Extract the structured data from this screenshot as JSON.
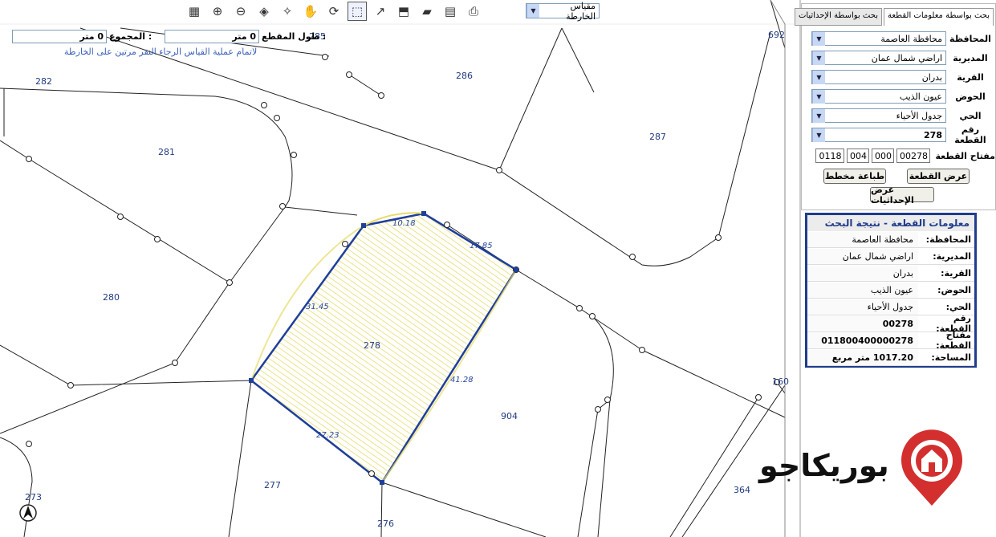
{
  "toolbar": {
    "tools": [
      "legend-icon",
      "zoom-in-icon",
      "zoom-out-icon",
      "layers-icon",
      "identify-icon",
      "pan-hand-icon",
      "refresh-map-icon",
      "measure-area-icon",
      "measure-distance-icon",
      "select-icon",
      "eraser-icon",
      "ruler-icon",
      "print-icon"
    ],
    "scale_value": "مقياس الخارطة"
  },
  "measure": {
    "total_label": "المجموع :",
    "total_value": "0 متر",
    "segment_label": "طول المقطع :",
    "segment_value": "0 متر",
    "hint": "لاتمام عملية القياس الرجاء النقر مرتين على الخارطة"
  },
  "map": {
    "parcels": [
      "282",
      "281",
      "280",
      "286",
      "287",
      "278",
      "904",
      "277",
      "276",
      "273",
      "364",
      "692",
      "285",
      "160"
    ],
    "dimensions": [
      "10.18",
      "17.85",
      "31.45",
      "41.28",
      "27.23"
    ],
    "north_symbol": "Λ"
  },
  "search_panel": {
    "tab_active": "بحث بواسطة معلومات القطعة",
    "tab_other": "بحث بواسطة الإحداثيات",
    "fields": [
      {
        "label": "المحافظة",
        "value": "محافظة العاصمة"
      },
      {
        "label": "المديرية",
        "value": "اراضي شمال عمان"
      },
      {
        "label": "القرية",
        "value": "بدران"
      },
      {
        "label": "الحوض",
        "value": "عيون الذيب"
      },
      {
        "label": "الحي",
        "value": "جدول الأحياء"
      },
      {
        "label": "رقم القطعة",
        "value": "278"
      }
    ],
    "key_label": "مفتاح القطعة",
    "key_parts": [
      "00278",
      "000",
      "004",
      "0118"
    ],
    "show_parcel_button": "عرض القطعة",
    "print_plan_button": "طباعة مخطط",
    "show_coords_button": "عرض الإحداثيات"
  },
  "info_panel": {
    "title": "معلومات القطعة - نتيجة البحث",
    "rows": [
      {
        "key": "المحافظة:",
        "value": "محافظة العاصمة"
      },
      {
        "key": "المديرية:",
        "value": "اراضي شمال عمان"
      },
      {
        "key": "القرية:",
        "value": "بدران"
      },
      {
        "key": "الحوض:",
        "value": "عيون الذيب"
      },
      {
        "key": "الحي:",
        "value": "جدول الأحياء"
      },
      {
        "key": "رقم القطعة:",
        "value": "00278"
      },
      {
        "key": "مفتاح القطعة:",
        "value": "011800400000278"
      },
      {
        "key": "المساحة:",
        "value": "1017.20 متر مربع"
      }
    ]
  },
  "brand": {
    "name": "بوريكاجو",
    "color": "#d32f2f"
  },
  "colors": {
    "parcel_line": "#1f3f9a",
    "highlight_fill": "#f3f0a8",
    "accent_blue": "#2848a0"
  }
}
